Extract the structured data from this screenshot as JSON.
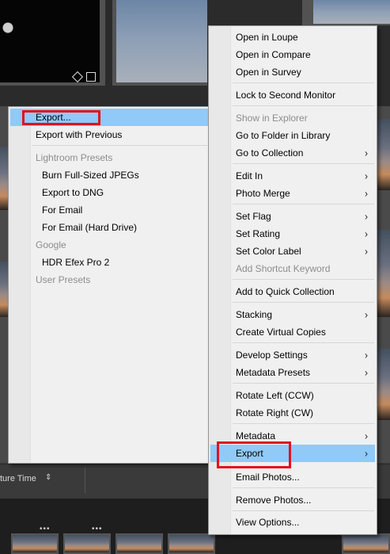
{
  "background": {
    "sort_label": "ture Time",
    "sort_arrow": "⇕",
    "dots": "•••"
  },
  "context_menu": {
    "items": [
      {
        "label": "Open in Loupe",
        "enabled": true
      },
      {
        "label": "Open in Compare",
        "enabled": true
      },
      {
        "label": "Open in Survey",
        "enabled": true
      },
      {
        "label": "Lock to Second Monitor",
        "enabled": true
      },
      {
        "label": "Show in Explorer",
        "enabled": false
      },
      {
        "label": "Go to Folder in Library",
        "enabled": true
      },
      {
        "label": "Go to Collection",
        "enabled": true,
        "submenu": true
      },
      {
        "label": "Edit In",
        "enabled": true,
        "submenu": true
      },
      {
        "label": "Photo Merge",
        "enabled": true,
        "submenu": true
      },
      {
        "label": "Set Flag",
        "enabled": true,
        "submenu": true
      },
      {
        "label": "Set Rating",
        "enabled": true,
        "submenu": true
      },
      {
        "label": "Set Color Label",
        "enabled": true,
        "submenu": true
      },
      {
        "label": "Add Shortcut Keyword",
        "enabled": false
      },
      {
        "label": "Add to Quick Collection",
        "enabled": true
      },
      {
        "label": "Stacking",
        "enabled": true,
        "submenu": true
      },
      {
        "label": "Create Virtual Copies",
        "enabled": true
      },
      {
        "label": "Develop Settings",
        "enabled": true,
        "submenu": true
      },
      {
        "label": "Metadata Presets",
        "enabled": true,
        "submenu": true
      },
      {
        "label": "Rotate Left (CCW)",
        "enabled": true
      },
      {
        "label": "Rotate Right (CW)",
        "enabled": true
      },
      {
        "label": "Metadata",
        "enabled": true,
        "submenu": true
      },
      {
        "label": "Export",
        "enabled": true,
        "submenu": true,
        "highlighted": true
      },
      {
        "label": "Email Photos...",
        "enabled": true
      },
      {
        "label": "Remove Photos...",
        "enabled": true
      },
      {
        "label": "View Options...",
        "enabled": true
      }
    ],
    "arrow_glyph": "›"
  },
  "export_submenu": {
    "items": [
      {
        "label": "Export...",
        "enabled": true,
        "highlighted": true
      },
      {
        "label": "Export with Previous",
        "enabled": true
      },
      {
        "label": "Lightroom Presets",
        "enabled": false,
        "header": true
      },
      {
        "label": "Burn Full-Sized JPEGs",
        "enabled": true
      },
      {
        "label": "Export to DNG",
        "enabled": true
      },
      {
        "label": "For Email",
        "enabled": true
      },
      {
        "label": "For Email (Hard Drive)",
        "enabled": true
      },
      {
        "label": "Google",
        "enabled": false,
        "header": true
      },
      {
        "label": "HDR Efex Pro 2",
        "enabled": true
      },
      {
        "label": "User Presets",
        "enabled": false,
        "header": true
      }
    ]
  },
  "colors": {
    "highlight": "#91c9f7",
    "annotation_red": "#e0131b",
    "menu_bg": "#f0f0f0"
  }
}
